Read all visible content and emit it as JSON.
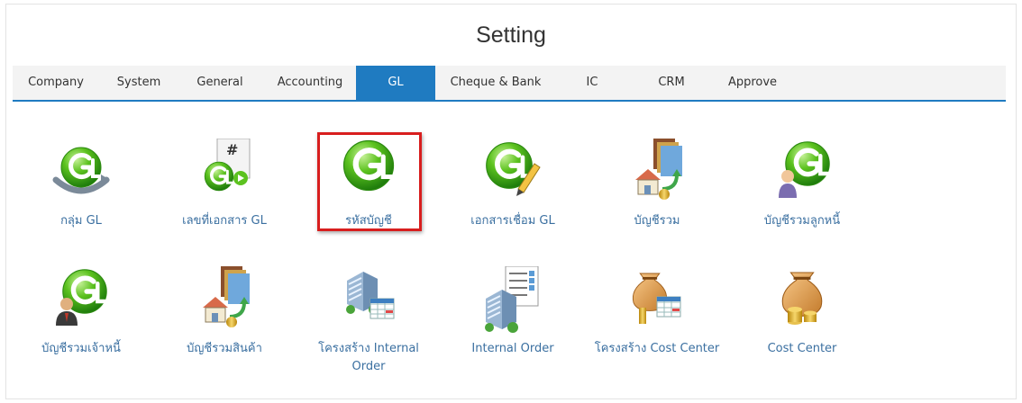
{
  "page": {
    "title": "Setting"
  },
  "tabs": [
    {
      "label": "Company"
    },
    {
      "label": "System"
    },
    {
      "label": "General"
    },
    {
      "label": "Accounting"
    },
    {
      "label": "GL",
      "active": true
    },
    {
      "label": "Cheque & Bank"
    },
    {
      "label": "IC"
    },
    {
      "label": "CRM"
    },
    {
      "label": "Approve"
    }
  ],
  "items": [
    {
      "label": "กลุ่ม GL",
      "icon": "gl-group-icon"
    },
    {
      "label": "เลขที่เอกสาร GL",
      "icon": "gl-document-number-icon"
    },
    {
      "label": "รหัสบัญชี",
      "icon": "gl-account-code-icon",
      "highlighted": true
    },
    {
      "label": "เอกสารเชื่อม GL",
      "icon": "gl-link-document-icon"
    },
    {
      "label": "บัญชีรวม",
      "icon": "consolidated-account-icon"
    },
    {
      "label": "บัญชีรวมลูกหนี้",
      "icon": "debtor-control-account-icon"
    },
    {
      "label": "บัญชีรวมเจ้าหนี้",
      "icon": "creditor-control-account-icon"
    },
    {
      "label": "บัญชีรวมสินค้า",
      "icon": "inventory-control-account-icon"
    },
    {
      "label": "โครงสร้าง Internal Order",
      "icon": "internal-order-structure-icon"
    },
    {
      "label": "Internal Order",
      "icon": "internal-order-icon"
    },
    {
      "label": "โครงสร้าง Cost Center",
      "icon": "cost-center-structure-icon"
    },
    {
      "label": "Cost Center",
      "icon": "cost-center-icon"
    }
  ],
  "colors": {
    "accent": "#1f7bc1",
    "highlight": "#d81e1e",
    "gl_green": "#4fb81e",
    "link": "#3a6fa0"
  }
}
